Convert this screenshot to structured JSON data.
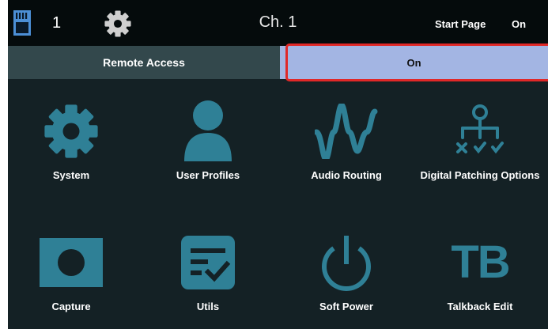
{
  "header": {
    "slot_number": "1",
    "channel_title": "Ch. 1",
    "start_page_label": "Start Page",
    "start_page_value": "On"
  },
  "remote_access": {
    "label": "Remote Access",
    "value": "On"
  },
  "tiles": [
    {
      "label": "System",
      "icon": "gear-icon"
    },
    {
      "label": "User Profiles",
      "icon": "user-icon"
    },
    {
      "label": "Audio Routing",
      "icon": "waveform-icon"
    },
    {
      "label": "Digital Patching Options",
      "icon": "patching-tree-icon"
    },
    {
      "label": "Capture",
      "icon": "capture-icon"
    },
    {
      "label": "Utils",
      "icon": "checklist-icon"
    },
    {
      "label": "Soft Power",
      "icon": "power-icon"
    },
    {
      "label": "Talkback Edit",
      "icon": "tb-icon",
      "glyph": "TB"
    }
  ],
  "colors": {
    "accent": "#2f8096",
    "highlight": "#e02828",
    "selected_bg": "#a3b5e3",
    "background": "#142125"
  }
}
